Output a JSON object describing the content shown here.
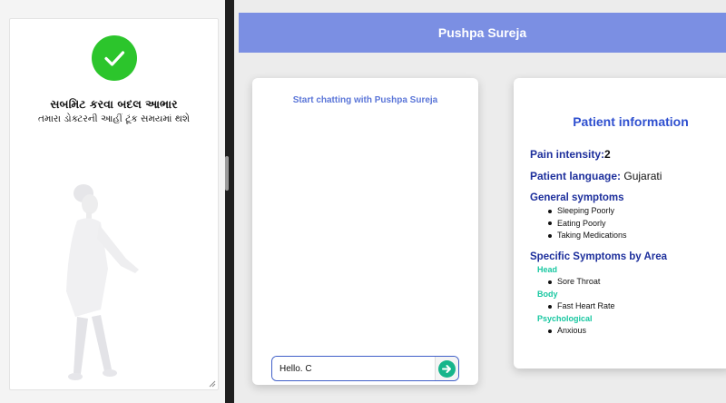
{
  "mobile": {
    "thanks_title": "સબમિટ કરવા બદલ આભાર",
    "thanks_subtitle": "તમારા ડોક્ટરની આહીં ટૂંક સમયમાં થશે",
    "check_icon": "check-circle-icon",
    "illustration": "doctor-illustration"
  },
  "header": {
    "title": "Pushpa Sureja",
    "color": "#7b8fe3"
  },
  "chat": {
    "heading": "Start chatting with Pushpa Sureja",
    "input_value": "Hello. C",
    "send_icon": "arrow-right-icon"
  },
  "patient_info": {
    "title": "Patient information",
    "pain_label": "Pain intensity:",
    "pain_value": "2",
    "language_label": "Patient language:",
    "language_value": "Gujarati",
    "general_title": "General symptoms",
    "general_symptoms": [
      "Sleeping Poorly",
      "Eating Poorly",
      "Taking Medications"
    ],
    "specific_title": "Specific Symptoms by Area",
    "areas": [
      {
        "name": "Head",
        "symptoms": [
          "Sore Throat"
        ]
      },
      {
        "name": "Body",
        "symptoms": [
          "Fast Heart Rate"
        ]
      },
      {
        "name": "Psychological",
        "symptoms": [
          "Anxious"
        ]
      }
    ]
  },
  "colors": {
    "accent_blue": "#2e4fcf",
    "area_green": "#18c7a1",
    "success_green": "#2cc52c"
  }
}
